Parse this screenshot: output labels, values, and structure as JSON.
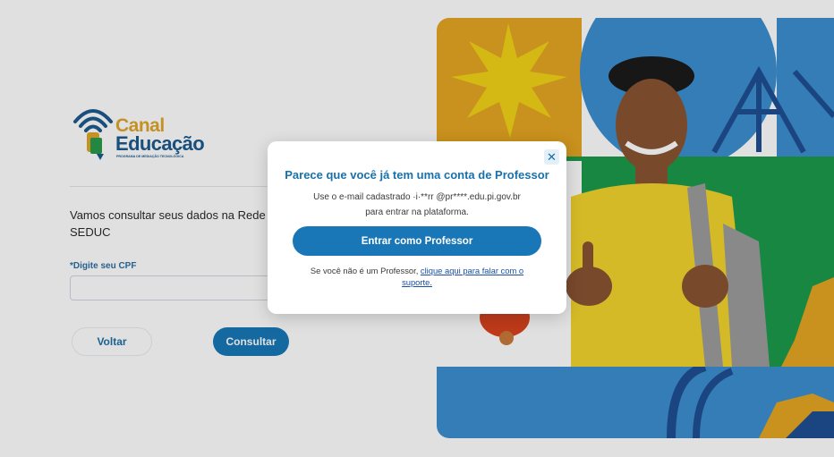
{
  "logo": {
    "word1": "Canal",
    "word2": "Educação",
    "tagline": "PROGRAMA DE MEDIAÇÃO TECNOLÓGICA"
  },
  "form": {
    "intro": "Vamos consultar seus dados na Rede SEDUC",
    "cpf_label": "*Digite seu CPF",
    "cpf_value": "",
    "back_label": "Voltar",
    "consult_label": "Consultar"
  },
  "modal": {
    "close_glyph": "✕",
    "title": "Parece que você já tem uma conta de Professor",
    "line1": "Use o e-mail cadastrado ·i·**rr @pr****.edu.pi.gov.br",
    "line2": "para entrar na plataforma.",
    "primary_button": "Entrar como Professor",
    "footer_text": "Se você não é um Professor, ",
    "footer_link": "clique aqui para falar com o suporte."
  },
  "colors": {
    "brand_blue": "#1a77b7",
    "brand_gold": "#e0a52a",
    "hero_yellow_block": "#e5a522",
    "hero_blue": "#3d8fd1",
    "hero_green": "#1c9a4a"
  },
  "icons": {
    "logo_icon": "wifi-signal-book-icon",
    "close_icon": "close-icon"
  }
}
